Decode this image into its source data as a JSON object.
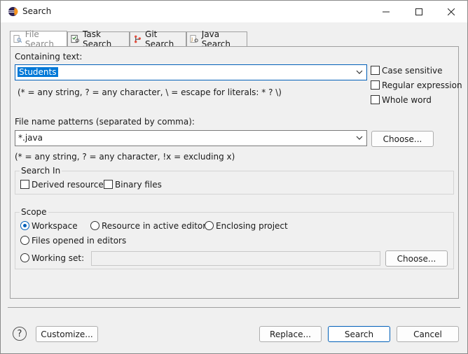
{
  "window": {
    "title": "Search"
  },
  "tabs": [
    {
      "label": "File Search",
      "icon": "file-search-icon"
    },
    {
      "label": "Task Search",
      "icon": "task-search-icon"
    },
    {
      "label": "Git Search",
      "icon": "git-search-icon"
    },
    {
      "label": "Java Search",
      "icon": "java-search-icon"
    }
  ],
  "containing_text": {
    "label": "Containing text:",
    "value": "Students",
    "hint": "(* = any string, ? = any character, \\ = escape for literals: * ? \\)"
  },
  "options": {
    "case_sensitive": "Case sensitive",
    "regular_expression": "Regular expression",
    "whole_word": "Whole word"
  },
  "file_patterns": {
    "label": "File name patterns (separated by comma):",
    "value": "*.java",
    "choose": "Choose...",
    "hint": "(* = any string, ? = any character, !x = excluding x)"
  },
  "search_in": {
    "title": "Search In",
    "derived": "Derived resources",
    "binary": "Binary files"
  },
  "scope": {
    "title": "Scope",
    "workspace": "Workspace",
    "active_editor": "Resource in active editor",
    "enclosing_project": "Enclosing project",
    "opened_editors": "Files opened in editors",
    "working_set": "Working set:",
    "choose": "Choose...",
    "selected": "Workspace"
  },
  "footer": {
    "customize": "Customize...",
    "replace": "Replace...",
    "search": "Search",
    "cancel": "Cancel"
  },
  "colors": {
    "accent": "#005fb8",
    "selection": "#0078d7"
  }
}
